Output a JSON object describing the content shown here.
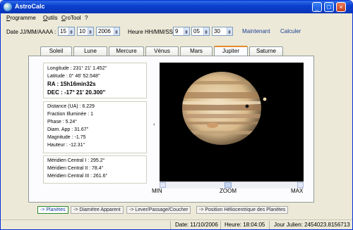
{
  "window": {
    "title": "AstroCalc"
  },
  "menu": [
    {
      "label": "Programme",
      "underline": "P",
      "rest": "rogramme"
    },
    {
      "label": "Outils",
      "underline": "O",
      "rest": "utils"
    },
    {
      "label": "CroTool",
      "underline": "C",
      "rest": "roTool"
    },
    {
      "label": "?",
      "underline": "",
      "rest": "?"
    }
  ],
  "date": {
    "label": "Date JJ/MM/AAAA :",
    "day": "15",
    "month": "10",
    "year": "2006"
  },
  "time": {
    "label": "Heure HH/MM/SS",
    "hour": "9",
    "minute": "05",
    "second": "30"
  },
  "links": {
    "now": "Maintenant",
    "calc": "Calculer"
  },
  "tabs": [
    "Soleil",
    "Lune",
    "Mercure",
    "Vénus",
    "Mars",
    "Jupiter",
    "Saturne"
  ],
  "active_tab": "Jupiter",
  "position_info": {
    "longitude": "Longitude : 231° 21' 1.452''",
    "latitude": "Latitude : 0° 46' 52.548''",
    "ra": "RA : 15h16min32s",
    "dec": "DEC : -17° 21' 20.300''"
  },
  "physical_info": {
    "distance": "Distance (UA) : 6.229",
    "fraction": "Fraction Illuminée : 1",
    "phase": "Phase : 5.24°",
    "diam": "Diam. App : 31.67''",
    "magnitude": "Magnitude : -1.75",
    "hauteur": "Hauteur : -12.31°"
  },
  "meridian_info": {
    "m1": "Méridien Central I : 295.2°",
    "m2": "Méridien Central II : 78.4°",
    "m3": "Méridien Central III : 261.6°"
  },
  "zoom": {
    "min": "MIN",
    "label": "ZOOM",
    "max": "MAX",
    "level": 0.47
  },
  "bottom_tabs": [
    "-> Planètes",
    "-> Diamètre Apparent",
    "-> Lever/Passage/Coucher",
    "-> Position Héliocentrique des Planètes"
  ],
  "status": {
    "date": "Date: 11/10/2006",
    "time": "Heure: 18:04:05",
    "julian": "Jour Julien: 2454023.8156713"
  },
  "colors": {
    "titlebar": "#0a3fce",
    "tab_highlight": "#e68b2c",
    "link": "#1c3f94"
  }
}
